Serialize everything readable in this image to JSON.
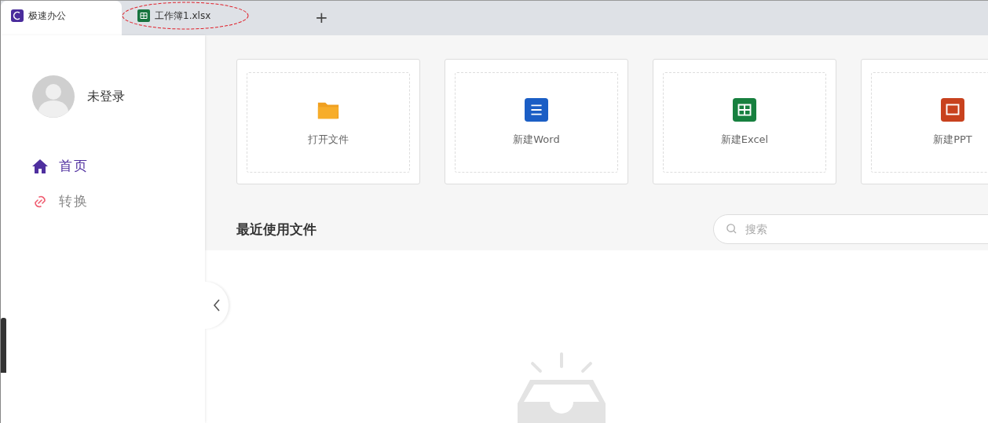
{
  "tabs": [
    {
      "label": "极速办公",
      "selected": true,
      "kind": "app",
      "circled": false
    },
    {
      "label": "工作簿1.xlsx",
      "selected": false,
      "kind": "excel",
      "circled": true
    }
  ],
  "new_tab_button": "+",
  "user": {
    "name": "未登录"
  },
  "nav": [
    {
      "label": "首页",
      "selected": true,
      "kind": "home"
    },
    {
      "label": "转换",
      "selected": false,
      "kind": "link"
    }
  ],
  "actions": [
    {
      "label": "打开文件",
      "kind": "folder"
    },
    {
      "label": "新建Word",
      "kind": "word"
    },
    {
      "label": "新建Excel",
      "kind": "excel"
    },
    {
      "label": "新建PPT",
      "kind": "ppt"
    }
  ],
  "recent": {
    "title": "最近使用文件",
    "search": {
      "placeholder": "搜索"
    }
  }
}
